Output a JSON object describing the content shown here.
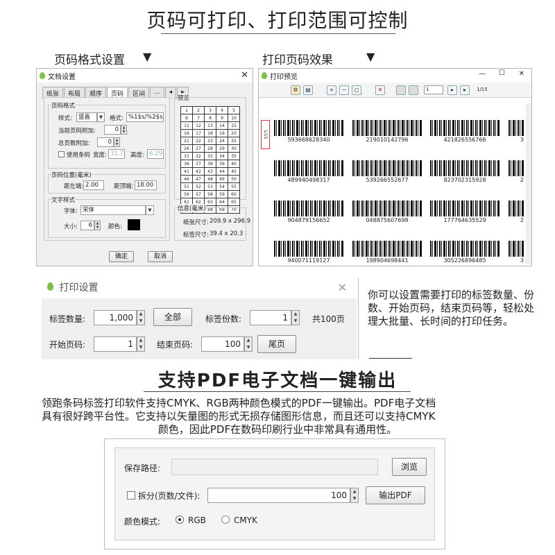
{
  "header": {
    "title": "页码可打印、打印范围可控制",
    "left_caption": "页码格式设置",
    "right_caption": "打印页码效果",
    "arrow": "▼"
  },
  "doc_dialog": {
    "title": "文档设置",
    "tabs": [
      "纸张",
      "布局",
      "顺序",
      "页码",
      "区间",
      "...",
      "◂",
      "▸"
    ],
    "page_format_legend": "页码格式",
    "style_label": "样式:",
    "style_value": "竖直",
    "format_label": "格式:",
    "format_value": "%1$s/%2$s",
    "cur_add_label": "当前页码附加:",
    "cur_add_value": "0",
    "total_add_label": "总页数附加:",
    "total_add_value": "0",
    "use_barcode_label": "使用条码",
    "width_label": "宽度:",
    "width_value": "31.75",
    "height_label": "高度:",
    "height_value": "6.29",
    "position_legend": "页码位置(毫米)",
    "left_label": "距左端:",
    "left_value": "2.00",
    "top_label": "距顶端:",
    "top_value": "18.00",
    "text_legend": "文字样式",
    "font_label": "字体:",
    "font_value": "宋体",
    "size_label": "大小:",
    "size_value": "6",
    "color_label": "颜色:",
    "preview_legend": "预览",
    "info_legend": "信息(毫米)",
    "paper_label": "纸张尺寸:",
    "paper_value": "209.9 x 296.9",
    "label_label": "标签尺寸:",
    "label_value": "39.4 x 20.3",
    "ok": "确定",
    "cancel": "取消",
    "grid_numbers": [
      "1",
      "2",
      "3",
      "4",
      "5",
      "6",
      "7",
      "8",
      "9",
      "10",
      "11",
      "12",
      "13",
      "14",
      "15",
      "16",
      "17",
      "18",
      "19",
      "20",
      "21",
      "22",
      "23",
      "24",
      "25",
      "26",
      "27",
      "28",
      "29",
      "30",
      "31",
      "32",
      "33",
      "34",
      "35",
      "36",
      "37",
      "38",
      "39",
      "40",
      "41",
      "42",
      "43",
      "44",
      "45",
      "46",
      "47",
      "48",
      "49",
      "50",
      "51",
      "52",
      "53",
      "54",
      "55",
      "56",
      "57",
      "58",
      "59",
      "60",
      "61",
      "62",
      "63",
      "64",
      "65",
      "66",
      "67",
      "68",
      "69",
      "70"
    ]
  },
  "preview_window": {
    "title": "打印预览",
    "min": "—",
    "max": "☐",
    "close": "✕",
    "page_input": "1",
    "page_total": "1/15",
    "page_tag": "1/15",
    "barcodes": [
      [
        "593668628340",
        "219010142796",
        "421826556766"
      ],
      [
        "489940498317",
        "539266552677",
        "823702315928"
      ],
      [
        "904879156652",
        "048875607698",
        "177764635529"
      ],
      [
        "940071119127",
        "198904698441",
        "305226896485"
      ]
    ],
    "edge_digits": [
      "3",
      "2",
      "2",
      "3"
    ]
  },
  "print_dialog": {
    "title": "打印设置",
    "qty_label": "标签数量:",
    "qty_value": "1,000",
    "all_button": "全部",
    "copies_label": "标签份数:",
    "copies_value": "1",
    "total_pages": "共100页",
    "start_label": "开始页码:",
    "start_value": "1",
    "end_label": "结束页码:",
    "end_value": "100",
    "last_button": "尾页"
  },
  "side_text": "你可以设置需要打印的标签数量、份数、开始页码，结束页码等，轻松处理大批量、长时间的打印任务。",
  "pdf_section": {
    "title": "支持PDF电子文档一键输出",
    "desc_1": "领跑条码标签打印软件支持CMYK、RGB两种颜色模式的PDF一键输出。PDF电子文档",
    "desc_2": "具有很好跨平台性。它支持以矢量图的形式无损存储图形信息，而且还可以支持CMYK",
    "desc_3": "颜色，因此PDF在数码印刷行业中非常具有通用性。"
  },
  "pdf_dialog": {
    "save_label": "保存路径:",
    "save_value": "",
    "browse": "浏览",
    "split_label": "拆分(页数/文件):",
    "split_value": "100",
    "export": "输出PDF",
    "color_label": "颜色模式:",
    "rgb": "RGB",
    "cmyk": "CMYK"
  }
}
